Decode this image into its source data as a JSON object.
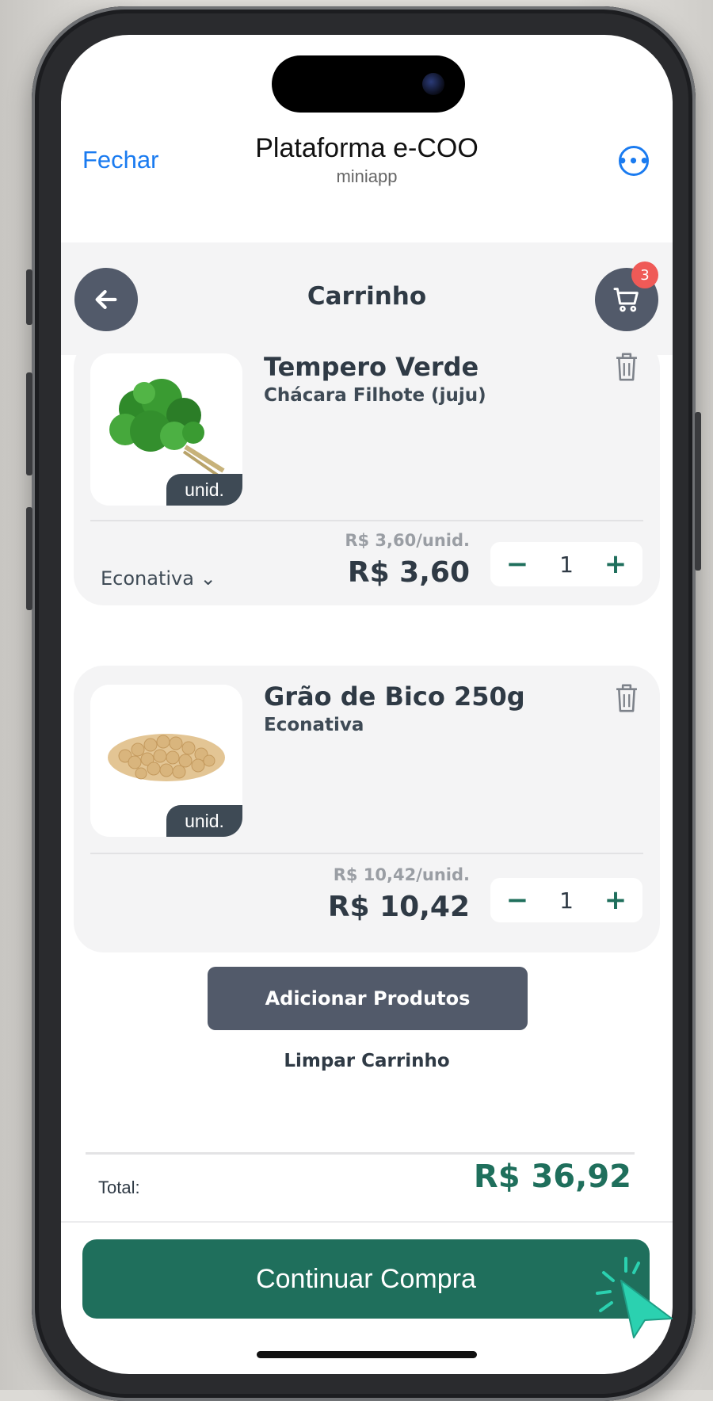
{
  "app": {
    "close_label": "Fechar",
    "title": "Plataforma e-COO",
    "subtitle": "miniapp",
    "more_icon": "more-horizontal-icon"
  },
  "page": {
    "title": "Carrinho",
    "back_icon": "arrow-left-icon",
    "cart_icon": "shopping-cart-icon",
    "cart_count": "3"
  },
  "products": [
    {
      "name": "Tempero Verde",
      "seller": "Chácara Filhote (juju)",
      "unit": "unid.",
      "unit_price": "R$ 3,60/unid.",
      "price": "R$ 3,60",
      "qty": "1",
      "minus": "−",
      "plus": "+"
    },
    {
      "name": "Grão de Bico 250g",
      "seller": "Econativa",
      "unit": "unid.",
      "unit_price": "R$ 10,42/unid.",
      "price": "R$ 10,42",
      "qty": "1",
      "minus": "−",
      "plus": "+"
    }
  ],
  "store_group": {
    "label": "Econativa ⌄"
  },
  "actions": {
    "add_products": "Adicionar Produtos",
    "clear_cart": "Limpar Carrinho",
    "continue": "Continuar Compra"
  },
  "summary": {
    "total_label": "Total:",
    "total_value": "R$ 36,92"
  },
  "colors": {
    "accent_green": "#1f6f5c",
    "dark_slate": "#525a6a",
    "badge_red": "#ef5a57",
    "link_blue": "#1a7bf0"
  }
}
